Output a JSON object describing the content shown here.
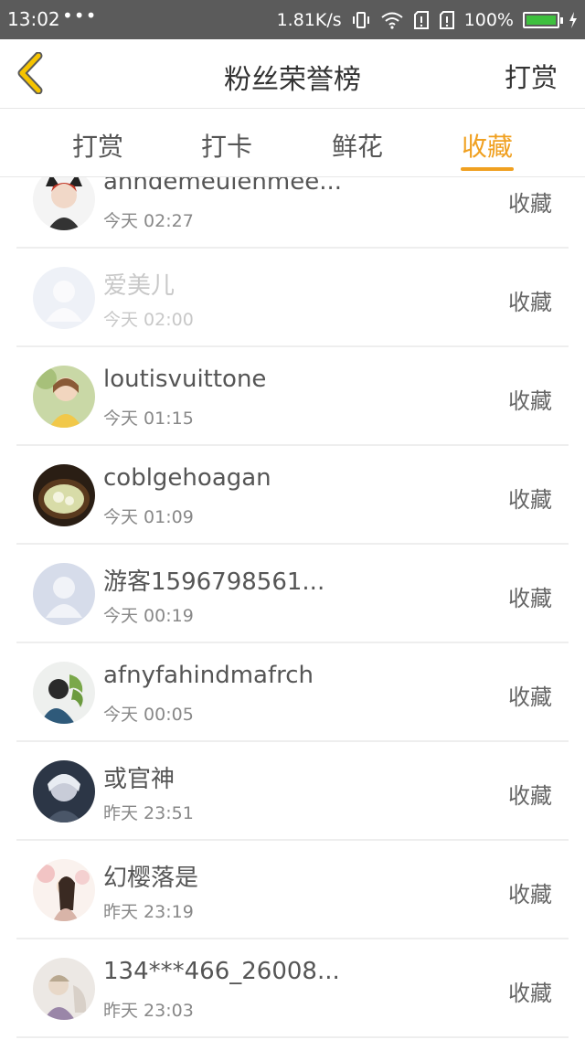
{
  "status": {
    "time": "13:02",
    "dots": "•••",
    "speed": "1.81K/s",
    "battery": "100%",
    "battery_level": 1.0,
    "battery_color": "#3ec03e"
  },
  "header": {
    "title": "粉丝荣誉榜",
    "action": "打赏",
    "back_icon": "chevron-left-icon",
    "accent": "#f0a020"
  },
  "tabs": [
    {
      "label": "打赏",
      "active": false
    },
    {
      "label": "打卡",
      "active": false
    },
    {
      "label": "鲜花",
      "active": false
    },
    {
      "label": "收藏",
      "active": true
    }
  ],
  "list": [
    {
      "name": "anndemeulenmee...",
      "time": "今天 02:27",
      "action": "收藏"
    },
    {
      "name": "爱美儿",
      "time": "今天 02:00",
      "action": "收藏"
    },
    {
      "name": "loutisvuittone",
      "time": "今天 01:15",
      "action": "收藏"
    },
    {
      "name": "coblgehoagan",
      "time": "今天 01:09",
      "action": "收藏"
    },
    {
      "name": "游客1596798561...",
      "time": "今天 00:19",
      "action": "收藏"
    },
    {
      "name": "afnyfahindmafrch",
      "time": "今天 00:05",
      "action": "收藏"
    },
    {
      "name": "或官神",
      "time": "昨天 23:51",
      "action": "收藏"
    },
    {
      "name": "幻樱落是",
      "time": "昨天 23:19",
      "action": "收藏"
    },
    {
      "name": "134***466_26008...",
      "time": "昨天 23:03",
      "action": "收藏"
    }
  ]
}
